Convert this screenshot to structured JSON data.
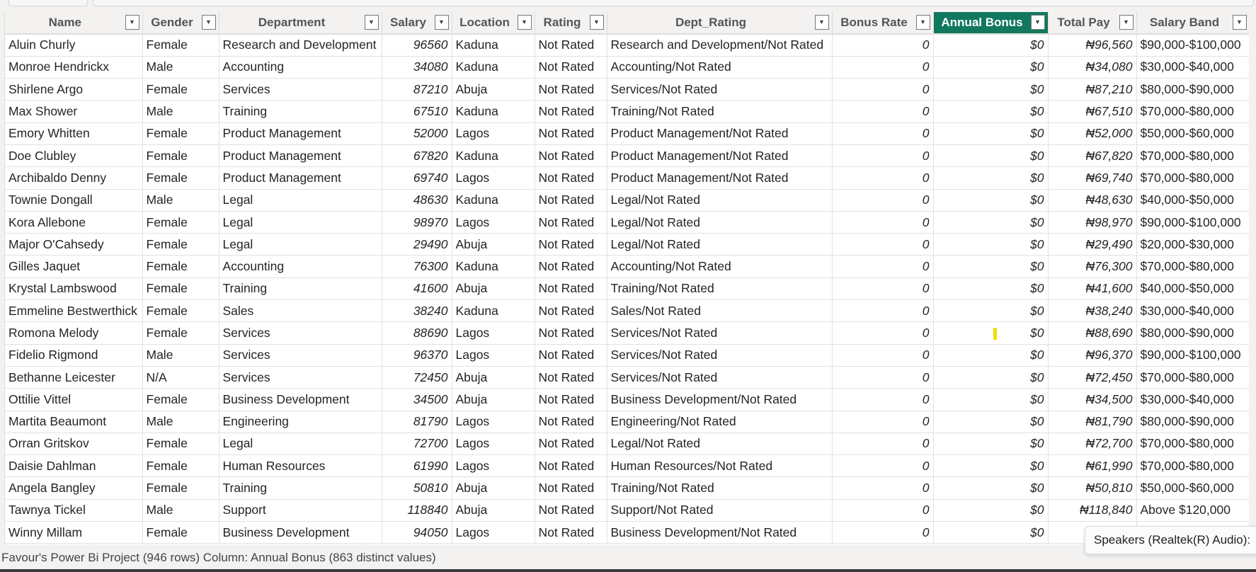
{
  "columns": [
    {
      "label": "Name",
      "numeric": false
    },
    {
      "label": "Gender",
      "numeric": false
    },
    {
      "label": "Department",
      "numeric": false
    },
    {
      "label": "Salary",
      "numeric": true
    },
    {
      "label": "Location",
      "numeric": false
    },
    {
      "label": "Rating",
      "numeric": false
    },
    {
      "label": "Dept_Rating",
      "numeric": false
    },
    {
      "label": "Bonus Rate",
      "numeric": true
    },
    {
      "label": "Annual Bonus",
      "numeric": true,
      "selected": true
    },
    {
      "label": "Total Pay",
      "numeric": true
    },
    {
      "label": "Salary Band",
      "numeric": false
    }
  ],
  "rows": [
    [
      "Aluin Churly",
      "Female",
      "Research and Development",
      "96560",
      "Kaduna",
      "Not Rated",
      "Research and Development/Not Rated",
      "0",
      "$0",
      "₦96,560",
      "$90,000-$100,000"
    ],
    [
      "Monroe Hendrickx",
      "Male",
      "Accounting",
      "34080",
      "Kaduna",
      "Not Rated",
      "Accounting/Not Rated",
      "0",
      "$0",
      "₦34,080",
      "$30,000-$40,000"
    ],
    [
      "Shirlene Argo",
      "Female",
      "Services",
      "87210",
      "Abuja",
      "Not Rated",
      "Services/Not Rated",
      "0",
      "$0",
      "₦87,210",
      "$80,000-$90,000"
    ],
    [
      "Max Shower",
      "Male",
      "Training",
      "67510",
      "Kaduna",
      "Not Rated",
      "Training/Not Rated",
      "0",
      "$0",
      "₦67,510",
      "$70,000-$80,000"
    ],
    [
      "Emory Whitten",
      "Female",
      "Product Management",
      "52000",
      "Lagos",
      "Not Rated",
      "Product Management/Not Rated",
      "0",
      "$0",
      "₦52,000",
      "$50,000-$60,000"
    ],
    [
      "Doe Clubley",
      "Female",
      "Product Management",
      "67820",
      "Kaduna",
      "Not Rated",
      "Product Management/Not Rated",
      "0",
      "$0",
      "₦67,820",
      "$70,000-$80,000"
    ],
    [
      "Archibaldo Denny",
      "Female",
      "Product Management",
      "69740",
      "Lagos",
      "Not Rated",
      "Product Management/Not Rated",
      "0",
      "$0",
      "₦69,740",
      "$70,000-$80,000"
    ],
    [
      "Townie Dongall",
      "Male",
      "Legal",
      "48630",
      "Kaduna",
      "Not Rated",
      "Legal/Not Rated",
      "0",
      "$0",
      "₦48,630",
      "$40,000-$50,000"
    ],
    [
      "Kora Allebone",
      "Female",
      "Legal",
      "98970",
      "Lagos",
      "Not Rated",
      "Legal/Not Rated",
      "0",
      "$0",
      "₦98,970",
      "$90,000-$100,000"
    ],
    [
      "Major O'Cahsedy",
      "Female",
      "Legal",
      "29490",
      "Abuja",
      "Not Rated",
      "Legal/Not Rated",
      "0",
      "$0",
      "₦29,490",
      "$20,000-$30,000"
    ],
    [
      "Gilles Jaquet",
      "Female",
      "Accounting",
      "76300",
      "Kaduna",
      "Not Rated",
      "Accounting/Not Rated",
      "0",
      "$0",
      "₦76,300",
      "$70,000-$80,000"
    ],
    [
      "Krystal Lambswood",
      "Female",
      "Training",
      "41600",
      "Abuja",
      "Not Rated",
      "Training/Not Rated",
      "0",
      "$0",
      "₦41,600",
      "$40,000-$50,000"
    ],
    [
      "Emmeline Bestwerthick",
      "Female",
      "Sales",
      "38240",
      "Kaduna",
      "Not Rated",
      "Sales/Not Rated",
      "0",
      "$0",
      "₦38,240",
      "$30,000-$40,000"
    ],
    [
      "Romona Melody",
      "Female",
      "Services",
      "88690",
      "Lagos",
      "Not Rated",
      "Services/Not Rated",
      "0",
      "$0",
      "₦88,690",
      "$80,000-$90,000"
    ],
    [
      "Fidelio Rigmond",
      "Male",
      "Services",
      "96370",
      "Lagos",
      "Not Rated",
      "Services/Not Rated",
      "0",
      "$0",
      "₦96,370",
      "$90,000-$100,000"
    ],
    [
      "Bethanne Leicester",
      "N/A",
      "Services",
      "72450",
      "Abuja",
      "Not Rated",
      "Services/Not Rated",
      "0",
      "$0",
      "₦72,450",
      "$70,000-$80,000"
    ],
    [
      "Ottilie Vittel",
      "Female",
      "Business Development",
      "34500",
      "Abuja",
      "Not Rated",
      "Business Development/Not Rated",
      "0",
      "$0",
      "₦34,500",
      "$30,000-$40,000"
    ],
    [
      "Martita Beaumont",
      "Male",
      "Engineering",
      "81790",
      "Lagos",
      "Not Rated",
      "Engineering/Not Rated",
      "0",
      "$0",
      "₦81,790",
      "$80,000-$90,000"
    ],
    [
      "Orran Gritskov",
      "Female",
      "Legal",
      "72700",
      "Lagos",
      "Not Rated",
      "Legal/Not Rated",
      "0",
      "$0",
      "₦72,700",
      "$70,000-$80,000"
    ],
    [
      "Daisie Dahlman",
      "Female",
      "Human Resources",
      "61990",
      "Lagos",
      "Not Rated",
      "Human Resources/Not Rated",
      "0",
      "$0",
      "₦61,990",
      "$70,000-$80,000"
    ],
    [
      "Angela Bangley",
      "Female",
      "Training",
      "50810",
      "Abuja",
      "Not Rated",
      "Training/Not Rated",
      "0",
      "$0",
      "₦50,810",
      "$50,000-$60,000"
    ],
    [
      "Tawnya Tickel",
      "Male",
      "Support",
      "118840",
      "Abuja",
      "Not Rated",
      "Support/Not Rated",
      "0",
      "$0",
      "₦118,840",
      "Above $120,000"
    ],
    [
      "Winny Millam",
      "Female",
      "Business Development",
      "94050",
      "Lagos",
      "Not Rated",
      "Business Development/Not Rated",
      "0",
      "$0",
      "",
      ""
    ]
  ],
  "status_bar": "Favour's Power Bi Project (946 rows) Column: Annual Bonus (863 distinct values)",
  "tooltip": "Speakers (Realtek(R) Audio):",
  "colors": {
    "selected_header": "#11785f",
    "cursor_marker": "#f5dd00"
  }
}
